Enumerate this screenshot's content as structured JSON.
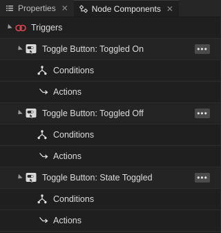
{
  "tabs": [
    {
      "label": "Properties",
      "icon": "properties-list-icon",
      "active": false
    },
    {
      "label": "Node Components",
      "icon": "node-components-icon",
      "active": true
    }
  ],
  "tab_close_glyph": "✕",
  "tree": {
    "root_label": "Triggers",
    "triggers": [
      {
        "label": "Toggle Button: Toggled On",
        "children": [
          "Conditions",
          "Actions"
        ]
      },
      {
        "label": "Toggle Button: Toggled Off",
        "children": [
          "Conditions",
          "Actions"
        ]
      },
      {
        "label": "Toggle Button: State Toggled",
        "children": [
          "Conditions",
          "Actions"
        ]
      }
    ]
  },
  "more_glyph": "•••",
  "colors": {
    "background": "#1f1f1f",
    "tab_bar": "#262626",
    "trigger_icon_red": "#e0454f",
    "text": "#dcdcdc"
  }
}
